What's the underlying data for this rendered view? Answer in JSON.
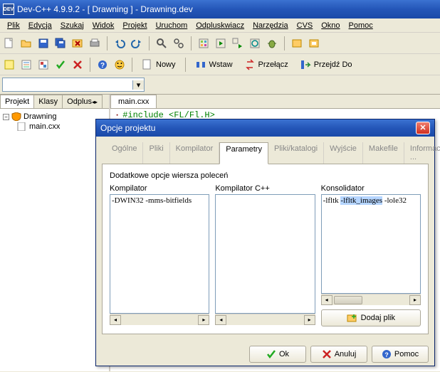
{
  "window": {
    "title": "Dev-C++ 4.9.9.2  -  [ Drawning ]  - Drawning.dev",
    "icon_text": "DEV"
  },
  "menu": {
    "items": [
      "Plik",
      "Edycja",
      "Szukaj",
      "Widok",
      "Projekt",
      "Uruchom",
      "Odpluskwiacz",
      "Narzędzia",
      "CVS",
      "Okno",
      "Pomoc"
    ]
  },
  "toolbar_labels": {
    "nowy": "Nowy",
    "wstaw": "Wstaw",
    "przelacz": "Przełącz",
    "przejdz": "Przejdź Do"
  },
  "left_tabs": [
    "Projekt",
    "Klasy",
    "Odplus"
  ],
  "tree": {
    "root": "Drawning",
    "child": "main.cxx"
  },
  "editor": {
    "tab": "main.cxx",
    "line": "#include <FL/Fl.H>"
  },
  "dialog": {
    "title": "Opcje projektu",
    "tabs": [
      "Ogólne",
      "Pliki",
      "Kompilator",
      "Parametry",
      "Pliki/katalogi",
      "Wyjście",
      "Makefile",
      "Informacje ..."
    ],
    "active_tab": "Parametry",
    "section_label": "Dodatkowe opcje wiersza poleceń",
    "kompilator_label": "Kompilator",
    "kompilator_value": "-DWIN32 -mms-bitfields",
    "kompilator_cpp_label": "Kompilator C++",
    "kompilator_cpp_value": "",
    "konsolidator_label": "Konsolidator",
    "konsolidator_prefix": "-lfltk ",
    "konsolidator_selected": "-lfltk_images",
    "konsolidator_suffix": " -lole32",
    "dodaj_plik": "Dodaj plik",
    "ok": "Ok",
    "anuluj": "Anuluj",
    "pomoc": "Pomoc"
  }
}
